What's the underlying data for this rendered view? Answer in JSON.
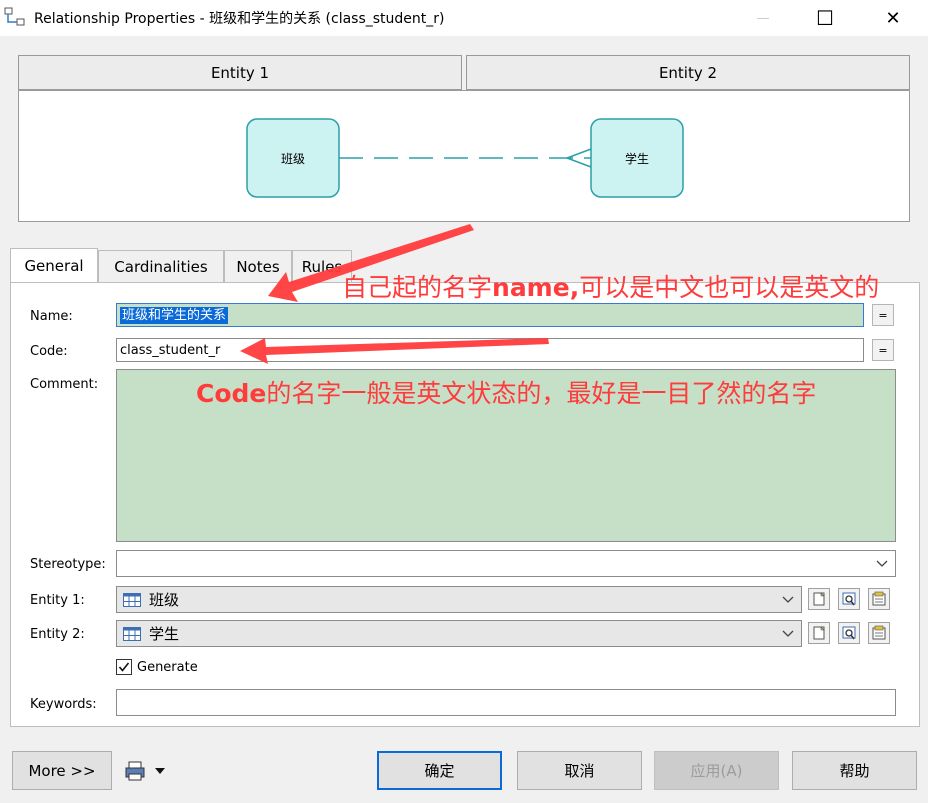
{
  "window": {
    "title": "Relationship Properties - 班级和学生的关系 (class_student_r)",
    "minimize_label": "—",
    "maximize_label": "☐",
    "close_label": "✕"
  },
  "header": {
    "entity1_label": "Entity 1",
    "entity2_label": "Entity 2"
  },
  "diagram": {
    "entity1": "班级",
    "entity2": "学生"
  },
  "tabs": [
    "General",
    "Cardinalities",
    "Notes",
    "Rules"
  ],
  "form": {
    "name_label": "Name:",
    "name_value": "班级和学生的关系",
    "code_label": "Code:",
    "code_value": "class_student_r",
    "eq_label": "=",
    "comment_label": "Comment:",
    "comment_value": "",
    "stereotype_label": "Stereotype:",
    "stereotype_value": "",
    "entity1_label": "Entity 1:",
    "entity1_value": "班级",
    "entity2_label": "Entity 2:",
    "entity2_value": "学生",
    "generate_label": "Generate",
    "generate_checked": true,
    "keywords_label": "Keywords:",
    "keywords_value": ""
  },
  "annotations": {
    "name_note_bold": "name,",
    "name_note_a": "自己起的名字",
    "name_note_b": "可以是中文也可以是英文的",
    "code_note_bold": "Code",
    "code_note_rest": "的名字一般是英文状态的，最好是一目了然的名字"
  },
  "buttons": {
    "more": "More >>",
    "ok": "确定",
    "cancel": "取消",
    "apply": "应用(A)",
    "help": "帮助"
  },
  "colors": {
    "entity_fill": "#cdf2f2",
    "entity_border": "#2aa0a8",
    "annotation": "#ff3b3b",
    "selection": "#0a6ad8",
    "comment_fill": "#c6e0c8"
  }
}
